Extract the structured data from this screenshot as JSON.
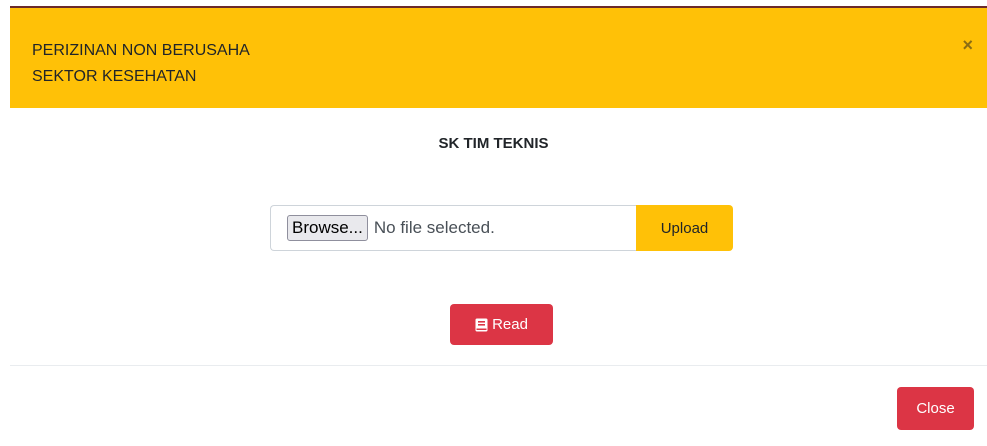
{
  "header": {
    "title_line1": "PERIZINAN NON BERUSAHA",
    "title_line2": "SEKTOR KESEHATAN",
    "close_symbol": "×",
    "color": "#ffc107"
  },
  "body": {
    "section_title": "SK TIM TEKNIS",
    "file_input": {
      "browse_label": "Browse...",
      "status": "No file selected."
    },
    "upload_label": "Upload",
    "read_label": "Read",
    "read_icon": "book-icon",
    "danger_color": "#dc3545"
  },
  "footer": {
    "close_label": "Close"
  }
}
